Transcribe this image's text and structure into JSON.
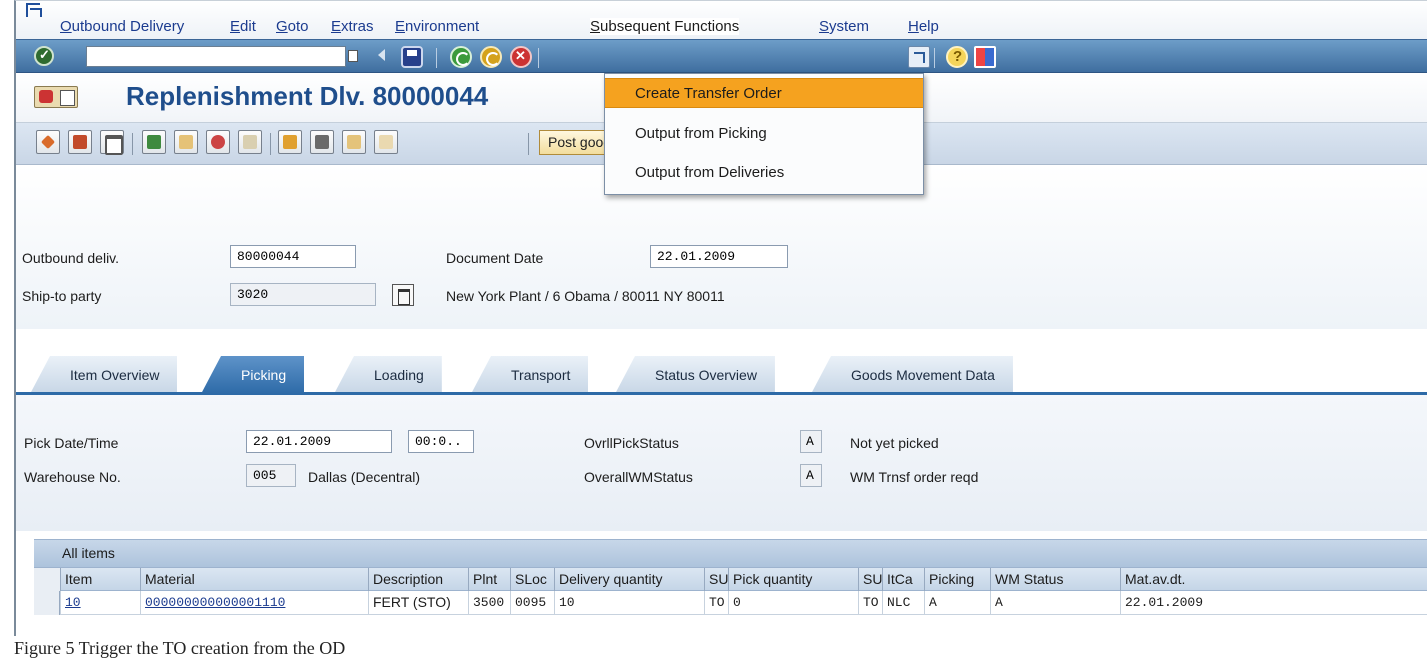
{
  "menubar": {
    "items": [
      "Outbound Delivery",
      "Edit",
      "Goto",
      "Extras",
      "Environment",
      "Subsequent Functions",
      "System",
      "Help"
    ]
  },
  "toolbar": {
    "command_value": "",
    "icons": [
      "enter-icon",
      "command-dropdown-icon",
      "back-arrow-icon",
      "save-icon",
      "back-icon",
      "exit-icon",
      "cancel-icon",
      "create-shortcut-icon",
      "help-icon",
      "layout-icon"
    ]
  },
  "title": {
    "text": "Replenishment Dlv. 80000044"
  },
  "app_toolbar": {
    "post_goods_issue_label": "Post goods issue"
  },
  "dropdown": {
    "items": [
      "Create Transfer Order",
      "Output from Picking",
      "Output from Deliveries"
    ],
    "highlighted_index": 0
  },
  "header": {
    "outbound_deliv_label": "Outbound deliv.",
    "outbound_deliv_value": "80000044",
    "document_date_label": "Document Date",
    "document_date_value": "22.01.2009",
    "ship_to_label": "Ship-to party",
    "ship_to_value": "3020",
    "ship_to_address": "New York Plant / 6 Obama / 80011 NY 80011"
  },
  "tabs": [
    {
      "label": "Item Overview",
      "active": false
    },
    {
      "label": "Picking",
      "active": true
    },
    {
      "label": "Loading",
      "active": false
    },
    {
      "label": "Transport",
      "active": false
    },
    {
      "label": "Status Overview",
      "active": false
    },
    {
      "label": "Goods Movement Data",
      "active": false
    }
  ],
  "picking": {
    "pick_date_label": "Pick Date/Time",
    "pick_date_value": "22.01.2009",
    "pick_time_value": "00:0..",
    "warehouse_label": "Warehouse No.",
    "warehouse_value": "005",
    "warehouse_desc": "Dallas (Decentral)",
    "ovrl_pick_status_label": "OvrllPickStatus",
    "ovrl_pick_status_value": "A",
    "ovrl_pick_status_text": "Not yet picked",
    "overall_wm_status_label": "OverallWMStatus",
    "overall_wm_status_value": "A",
    "overall_wm_status_text": "WM Trnsf order reqd"
  },
  "table": {
    "title": "All items",
    "columns": [
      "Item",
      "Material",
      "Description",
      "Plnt",
      "SLoc",
      "Delivery quantity",
      "SU",
      "Pick quantity",
      "SU",
      "ItCa",
      "Picking",
      "WM Status",
      "Mat.av.dt."
    ],
    "rows": [
      [
        "10",
        "000000000000001110",
        "FERT (STO)",
        "3500",
        "0095",
        "10",
        "TO",
        "0",
        "TO",
        "NLC",
        "A",
        "A",
        "22.01.2009"
      ]
    ]
  },
  "caption": "Figure 5   Trigger the TO creation from the OD"
}
